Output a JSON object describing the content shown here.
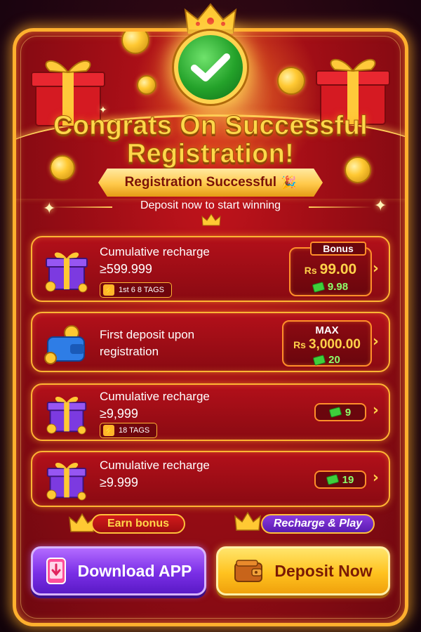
{
  "header": {
    "title_line1": "Congrats On Successful",
    "title_line2": "Registration!",
    "ribbon": "Registration Successful",
    "subtitle": "Deposit now to start winning"
  },
  "offers": [
    {
      "label": "Cumulative recharge",
      "amount": "≥599.999",
      "tag": "1st 6 8 TAGS",
      "bonus_label": "Bonus",
      "currency": "Rs",
      "value": "99.00",
      "cash": "9.98"
    },
    {
      "label_line1": "First deposit upon",
      "label_line2": "registration",
      "max_label": "MAX",
      "currency": "Rs",
      "value": "3,000.00",
      "cash": "20"
    },
    {
      "label": "Cumulative recharge",
      "amount": "≥9,999",
      "tag": "18 TAGS",
      "cash": "9"
    },
    {
      "label": "Cumulative recharge",
      "amount": "≥9.999",
      "cash": "19"
    }
  ],
  "badges": {
    "earn": "Earn bonus",
    "recharge": "Recharge & Play"
  },
  "buttons": {
    "download": "Download APP",
    "deposit": "Deposit Now"
  },
  "colors": {
    "frame": "#ffb02e",
    "background": "#9c0d15",
    "gold": "#ffd84a",
    "cash_green": "#8dff6a",
    "download_purple": "#7a2ee6",
    "deposit_yellow": "#ffc21f"
  },
  "icons": [
    "crown-icon",
    "check-icon",
    "gift-icon",
    "coin-icon",
    "party-popper-icon",
    "wallet-icon",
    "bolt-icon",
    "cash-icon",
    "chevron-right-icon",
    "phone-download-icon"
  ]
}
